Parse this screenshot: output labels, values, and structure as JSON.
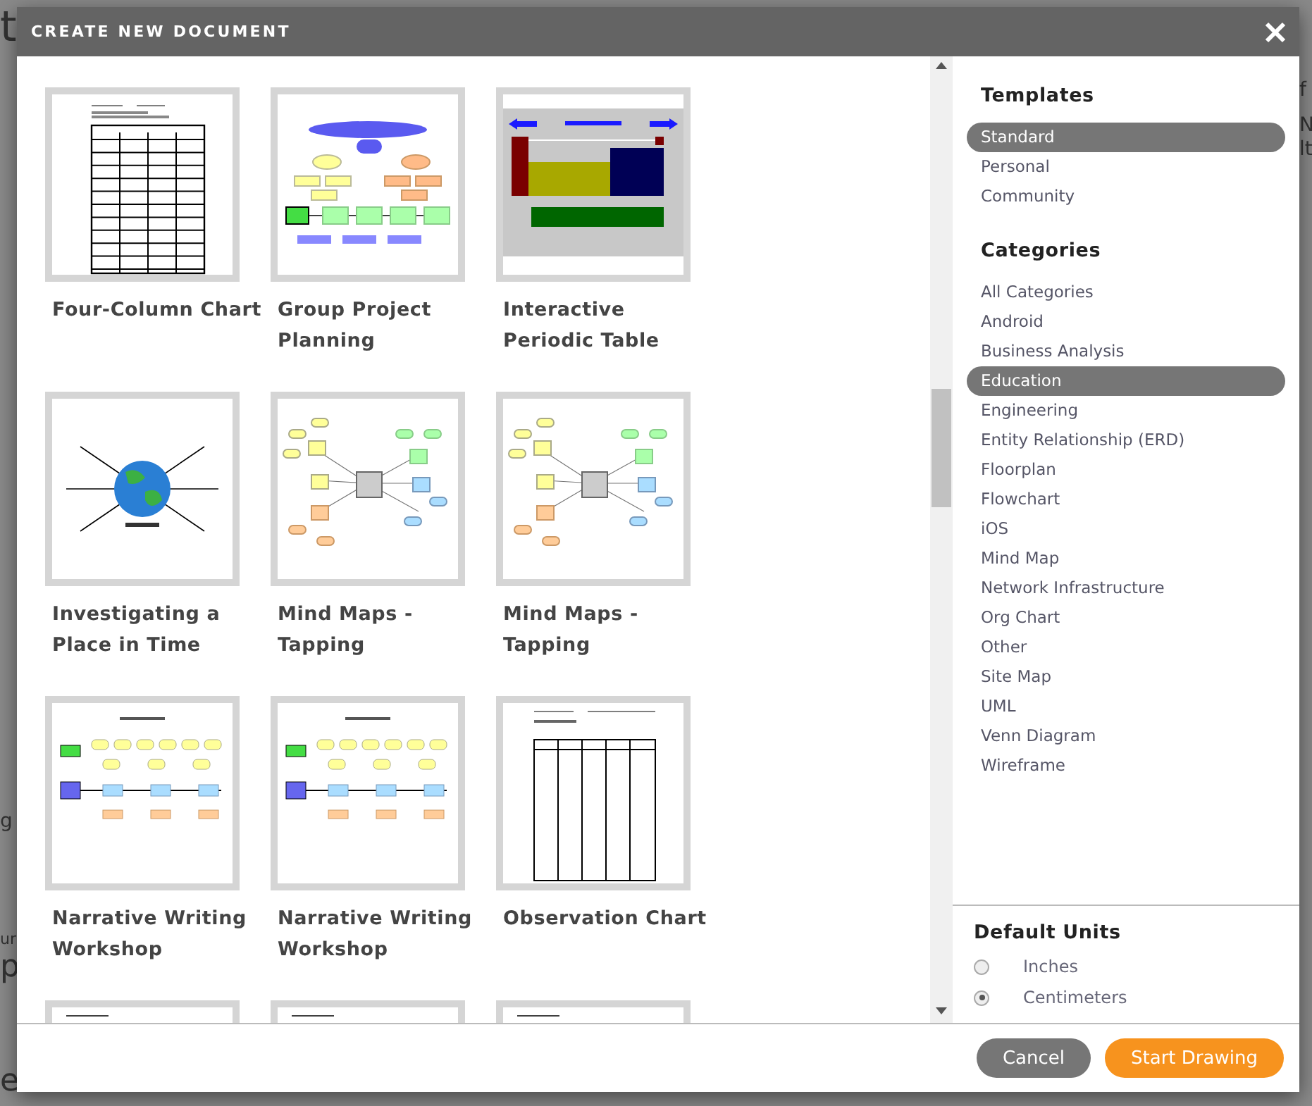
{
  "background": {
    "fragments": [
      {
        "text": "t"
      },
      {
        "text": "f"
      },
      {
        "text": "N"
      },
      {
        "text": "lt"
      },
      {
        "text": "g"
      },
      {
        "text": "ur"
      },
      {
        "text": "p"
      },
      {
        "text": "e"
      }
    ]
  },
  "dialog": {
    "title": "CREATE NEW DOCUMENT"
  },
  "templates": [
    {
      "title": "Four-Column Chart",
      "kind": "table"
    },
    {
      "title": "Group Project Planning",
      "kind": "project"
    },
    {
      "title": "Interactive Periodic Table",
      "kind": "periodic"
    },
    {
      "title": "Investigating a Place in Time",
      "kind": "globe"
    },
    {
      "title": "Mind Maps - Tapping",
      "kind": "mindmap"
    },
    {
      "title": "Mind Maps - Tapping",
      "kind": "mindmap"
    },
    {
      "title": "Narrative Writing Workshop",
      "kind": "narrative"
    },
    {
      "title": "Narrative Writing Workshop",
      "kind": "narrative"
    },
    {
      "title": "Observation Chart",
      "kind": "observation"
    },
    {
      "kind": "partial"
    },
    {
      "kind": "partial"
    },
    {
      "kind": "partial"
    }
  ],
  "sidebar": {
    "templates_heading": "Templates",
    "template_sources": [
      {
        "label": "Standard",
        "selected": true
      },
      {
        "label": "Personal",
        "selected": false
      },
      {
        "label": "Community",
        "selected": false
      }
    ],
    "categories_heading": "Categories",
    "categories": [
      {
        "label": "All Categories",
        "selected": false
      },
      {
        "label": "Android",
        "selected": false
      },
      {
        "label": "Business Analysis",
        "selected": false
      },
      {
        "label": "Education",
        "selected": true
      },
      {
        "label": "Engineering",
        "selected": false
      },
      {
        "label": "Entity Relationship (ERD)",
        "selected": false
      },
      {
        "label": "Floorplan",
        "selected": false
      },
      {
        "label": "Flowchart",
        "selected": false
      },
      {
        "label": "iOS",
        "selected": false
      },
      {
        "label": "Mind Map",
        "selected": false
      },
      {
        "label": "Network Infrastructure",
        "selected": false
      },
      {
        "label": "Org Chart",
        "selected": false
      },
      {
        "label": "Other",
        "selected": false
      },
      {
        "label": "Site Map",
        "selected": false
      },
      {
        "label": "UML",
        "selected": false
      },
      {
        "label": "Venn Diagram",
        "selected": false
      },
      {
        "label": "Wireframe",
        "selected": false
      }
    ],
    "units_heading": "Default Units",
    "units": [
      {
        "label": "Inches",
        "selected": false
      },
      {
        "label": "Centimeters",
        "selected": true
      }
    ]
  },
  "buttons": [
    {
      "label": "Cancel",
      "kind": "secondary"
    },
    {
      "label": "Start Drawing",
      "kind": "primary"
    }
  ]
}
